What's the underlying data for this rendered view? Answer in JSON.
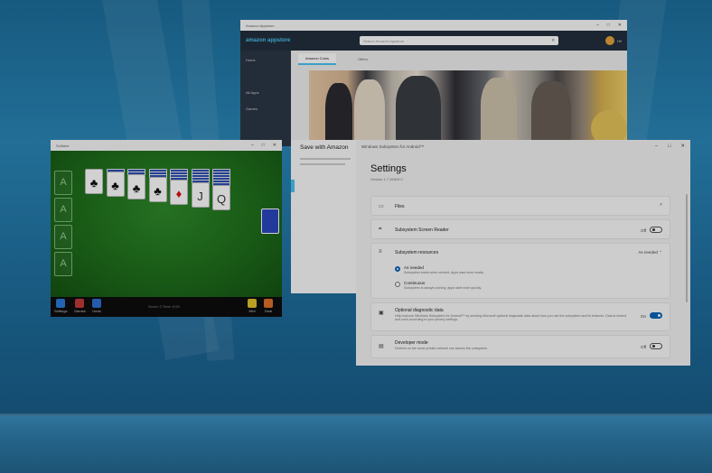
{
  "amazon": {
    "window_title": "Amazon Appstore",
    "logo": "amazon appstore",
    "search_placeholder": "Search Amazon Appstore",
    "user": "Hi!",
    "sidebar": [
      "Home",
      "All Apps",
      "Games"
    ],
    "tabs": [
      "Amazon Coins",
      "Offers"
    ],
    "panel_title": "Save with Amazon"
  },
  "solitaire": {
    "window_title": "Solitaire",
    "toolbar": [
      {
        "label": "Settings",
        "icon": "gear-icon",
        "color": "#2a7bd8"
      },
      {
        "label": "Games",
        "icon": "cards-icon",
        "color": "#c13a3a"
      },
      {
        "label": "Undo",
        "icon": "undo-icon",
        "color": "#2d6fd1"
      },
      {
        "label": "Hint",
        "icon": "lightbulb-icon",
        "color": "#e2c12e"
      },
      {
        "label": "Deal",
        "icon": "deal-icon",
        "color": "#e0702a"
      }
    ],
    "status": "Score: 0   Time: 0:00",
    "foundations": [
      "A",
      "A",
      "A",
      "A"
    ],
    "tableau_tops": [
      {
        "suit": "♣",
        "color": "#111"
      },
      {
        "suit": "♣",
        "color": "#111"
      },
      {
        "suit": "♣",
        "color": "#111"
      },
      {
        "suit": "♣",
        "color": "#111"
      },
      {
        "suit": "♦",
        "color": "#d11"
      },
      {
        "suit": "J",
        "color": "#333"
      },
      {
        "suit": "Q",
        "color": "#333"
      }
    ]
  },
  "settings": {
    "window_title": "Windows Subsystem for Android™",
    "heading": "Settings",
    "version": "Version 1.7.32815.0",
    "files_label": "Files",
    "screen_reader_label": "Subsystem Screen Reader",
    "screen_reader_state": "Off",
    "resources_label": "Subsystem resources",
    "resources_value": "As needed",
    "option_as_needed": "As needed",
    "option_as_needed_desc": "Subsystem starts when needed. Apps start more slowly.",
    "option_continuous": "Continuous",
    "option_continuous_desc": "Subsystem is always running; apps start more quickly.",
    "diagnostics_label": "Optional diagnostic data",
    "diagnostics_desc": "Help improve Windows Subsystem for Android™ by sending Microsoft optional diagnostic data about how you use the subsystem and its features. Data is shared and used according to your privacy settings.",
    "diagnostics_state": "On",
    "developer_label": "Developer mode",
    "developer_desc": "Devices on the same private network can access the subsystem.",
    "developer_state": "Off"
  }
}
